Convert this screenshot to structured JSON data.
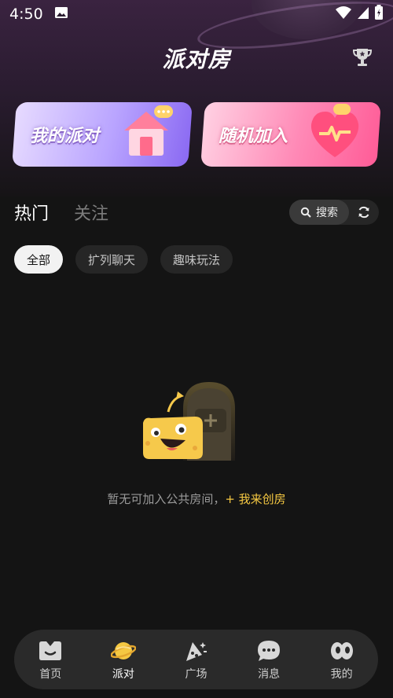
{
  "status_bar": {
    "time": "4:50"
  },
  "header": {
    "title": "派对房"
  },
  "cards": [
    {
      "label": "我的派对"
    },
    {
      "label": "随机加入"
    }
  ],
  "tabs": [
    {
      "label": "热门",
      "active": true
    },
    {
      "label": "关注",
      "active": false
    }
  ],
  "search": {
    "label": "搜索"
  },
  "chips": [
    {
      "label": "全部",
      "active": true
    },
    {
      "label": "扩列聊天",
      "active": false
    },
    {
      "label": "趣味玩法",
      "active": false
    }
  ],
  "empty_state": {
    "message": "暂无可加入公共房间，",
    "action": "+ 我来创房"
  },
  "bottom_nav": [
    {
      "label": "首页",
      "icon": "home-icon"
    },
    {
      "label": "派对",
      "icon": "planet-icon",
      "active": true
    },
    {
      "label": "广场",
      "icon": "plaza-icon"
    },
    {
      "label": "消息",
      "icon": "message-icon"
    },
    {
      "label": "我的",
      "icon": "profile-icon"
    }
  ],
  "colors": {
    "accent_yellow": "#f5c842",
    "background": "#141414",
    "nav_bg": "#2a2a2a",
    "party_card": "#a58cff",
    "random_card": "#ff7aab"
  }
}
